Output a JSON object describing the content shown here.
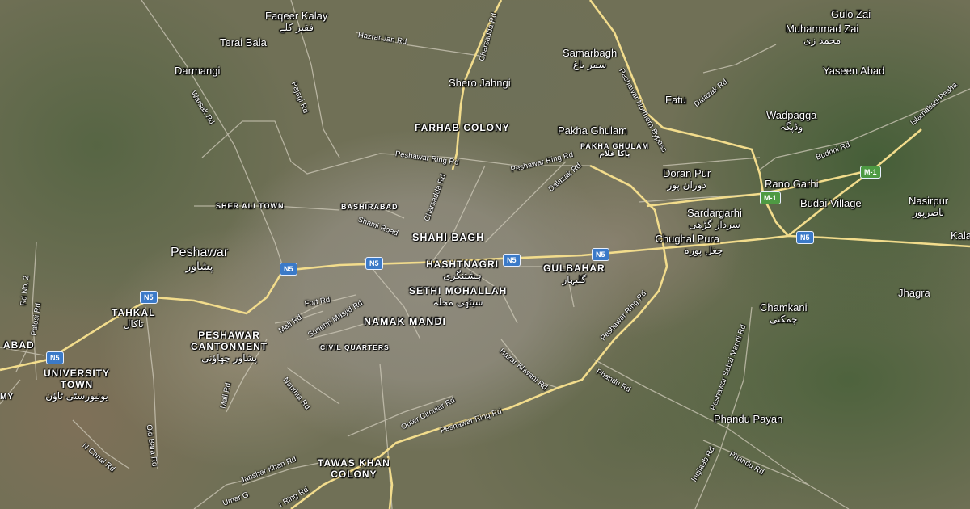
{
  "places": {
    "faqeer_kalay": {
      "name": "Faqeer Kalay",
      "urdu": "فقیر کلے"
    },
    "terai_bala": {
      "name": "Terai Bala"
    },
    "darmangi": {
      "name": "Darmangi"
    },
    "shero_jahngi": {
      "name": "Shero Jahngi"
    },
    "samarbagh": {
      "name": "Samarbagh",
      "urdu": "سمر باغ"
    },
    "gulo_zai": {
      "name": "Gulo Zai"
    },
    "muhammad_zai": {
      "name": "Muhammad Zai",
      "urdu": "محمد زی"
    },
    "yaseen_abad": {
      "name": "Yaseen Abad"
    },
    "fatu": {
      "name": "Fatu"
    },
    "wadpagga": {
      "name": "Wadpagga",
      "urdu": "وڈپگہ"
    },
    "farhab_colony": {
      "name": "FARHAB COLONY"
    },
    "pakha_ghulam": {
      "name": "Pakha Ghulam"
    },
    "pakha_ghulam_caps": {
      "name": "PAKHA GHULAM",
      "urdu": "پاکا غلام"
    },
    "doran_pur": {
      "name": "Doran Pur",
      "urdu": "دوران پور"
    },
    "rano_garhi": {
      "name": "Rano Garhi"
    },
    "budai_village": {
      "name": "Budai Village"
    },
    "nasirpur": {
      "name": "Nasirpur",
      "urdu": "ناصرپور"
    },
    "sher_ali_town": {
      "name": "SHER ALI TOWN"
    },
    "bashirabad": {
      "name": "BASHIRABAD"
    },
    "shahi_bagh": {
      "name": "SHAHI BAGH"
    },
    "sardargarhi": {
      "name": "Sardargarhi",
      "urdu": "سردار گڑھی"
    },
    "chughal_pura": {
      "name": "Chughal Pura",
      "urdu": "چغل پورہ"
    },
    "kala": {
      "name": "Kala"
    },
    "peshawar": {
      "name": "Peshawar",
      "urdu": "پشاور"
    },
    "hashtnagri": {
      "name": "HASHTNAGRI",
      "urdu": "ہشتنگری"
    },
    "gulbahar": {
      "name": "GULBAHAR",
      "urdu": "گلبہار"
    },
    "sethi_mohallah": {
      "name": "SETHI MOHALLAH",
      "urdu": "سیٹھی محلہ"
    },
    "jhagra": {
      "name": "Jhagra"
    },
    "tahkal": {
      "name": "TAHKAL",
      "urdu": "تاکال"
    },
    "namak_mandi": {
      "name": "NAMAK MANDI"
    },
    "chamkani": {
      "name": "Chamkani",
      "urdu": "چمکنی"
    },
    "peshawar_cantonment": {
      "line1": "PESHAWAR",
      "line2": "CANTONMENT",
      "urdu": "پشاور چھاؤنی"
    },
    "civil_quarters": {
      "name": "CIVIL QUARTERS"
    },
    "abad": {
      "name": "ABAD"
    },
    "university_town": {
      "line1": "UNIVERSITY",
      "line2": "TOWN",
      "urdu": "یونیورسٹی ٹاؤن"
    },
    "my": {
      "name": "MY"
    },
    "phandu_payan": {
      "name": "Phandu Payan"
    },
    "tawas_khan_colony": {
      "line1": "TAWAS KHAN",
      "line2": "COLONY"
    }
  },
  "roads": {
    "charsadda_rd_n": "Charsadda Rd",
    "hazrat_jan_rd": "Hazrat Jan Rd",
    "pajagi_rd": "Pajagi Rd",
    "warsak_rd": "Warsak Rd",
    "peshawar_northern_bypass": "Peshawar Northern Bypass",
    "dalazak_rd_ne": "Dalazak Rd",
    "budhni_rd": "Budhni Rd",
    "islamabad_peshawar": "Islamabad-Pesha",
    "peshawar_ring_rd_n1": "Peshawar Ring Rd",
    "peshawar_ring_rd_n2": "Peshawar Ring Rd",
    "dalazak_rd": "Dalazak Rd",
    "charsadda_rd": "Charsadda Rd",
    "shami_road": "Shami Road",
    "fort_rd": "Fort Rd",
    "mall_rd_n": "Mall Rd",
    "sunehri_masjid_rd": "Sunehri Masjid Rd",
    "peshawar_ring_rd_e": "Peshawar Ring Rd",
    "hazar_khwani_rd": "Hazar Khwani Rd",
    "phandu_rd": "Phandu Rd",
    "peshawar_sabzi_mandi_rd": "Peshawar Sabzi Mandi Rd",
    "mall_rd": "Mall Rd",
    "palosi_rd": "Palosi Rd",
    "rd_no_2": "Rd No. 2",
    "old_bara_rd": "Old Bara Rd",
    "n_canal_rd": "N Canal Rd",
    "nauthia_rd": "Nauthia Rd",
    "outer_circular_rd": "Outer Circular Rd",
    "peshawar_ring_rd_s": "Peshawar Ring Rd",
    "jansher_khan_rd": "Jansher Khan Rd",
    "inqilaab_rd": "Inqilaab Rd",
    "phandu_rd_s": "Phandu Rd",
    "umar_g": "Umar G",
    "ring_rd_sw": "r Ring Rd"
  },
  "shields": [
    "N5",
    "N5",
    "N5",
    "N5",
    "N5",
    "N5",
    "M-1",
    "M-1"
  ],
  "colors": {
    "highway": "#f2dc8c",
    "minor_road": "#c9c5b8",
    "shield_n": "#3b7ac8",
    "shield_m": "#4e9a43"
  }
}
